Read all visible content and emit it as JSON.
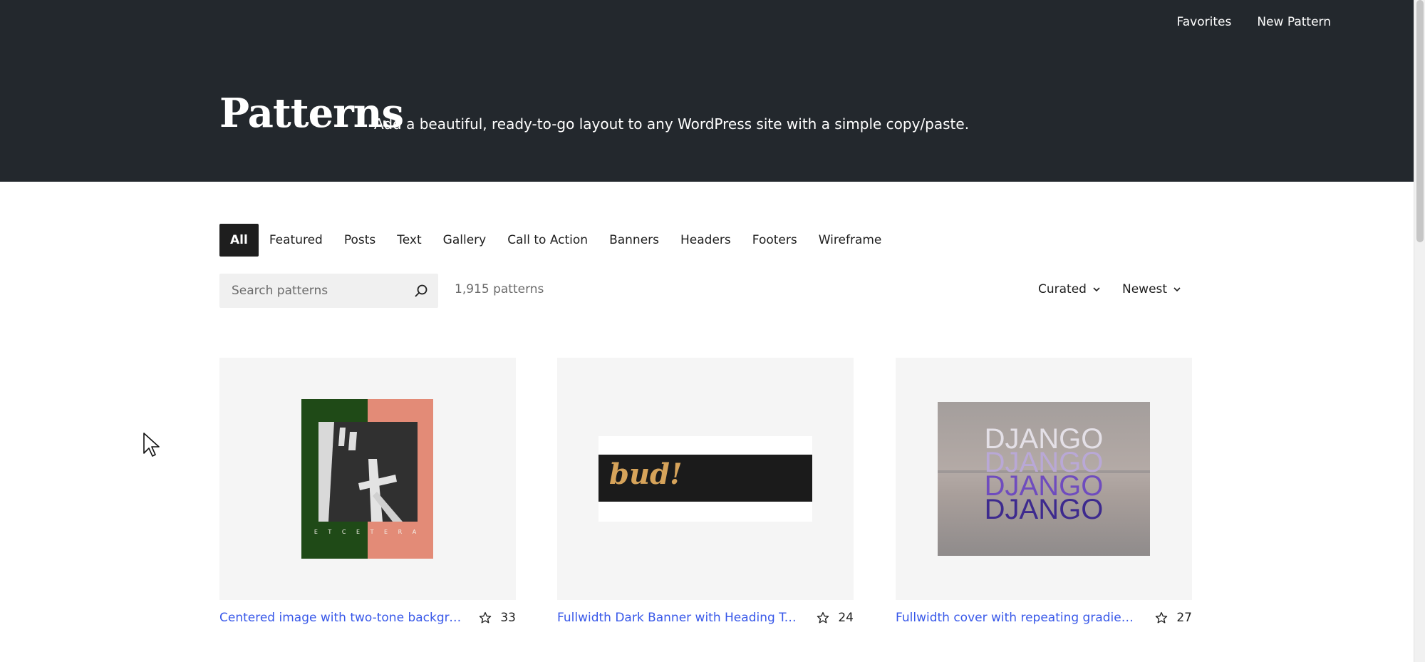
{
  "header": {
    "nav": [
      {
        "label": "Favorites"
      },
      {
        "label": "New Pattern"
      }
    ],
    "title": "Patterns",
    "tagline": "Add a beautiful, ready-to-go layout to any WordPress site with a simple copy/paste."
  },
  "categories": [
    {
      "label": "All",
      "active": true
    },
    {
      "label": "Featured"
    },
    {
      "label": "Posts"
    },
    {
      "label": "Text"
    },
    {
      "label": "Gallery"
    },
    {
      "label": "Call to Action"
    },
    {
      "label": "Banners"
    },
    {
      "label": "Headers"
    },
    {
      "label": "Footers"
    },
    {
      "label": "Wireframe"
    }
  ],
  "toolbar": {
    "search_placeholder": "Search patterns",
    "search_icon": "search-icon",
    "count": "1,915 patterns",
    "curated_label": "Curated",
    "sort_label": "Newest"
  },
  "cards": [
    {
      "title": "Centered image with two-tone backgrou...",
      "favorites": "33",
      "thumb_caption": "E T C E T E R A"
    },
    {
      "title": "Fullwidth Dark Banner with Heading Top ...",
      "favorites": "24",
      "thumb_text": "bud!"
    },
    {
      "title": "Fullwidth cover with repeating gradient t...",
      "favorites": "27",
      "thumb_words": [
        "DJANGO",
        "DJANGO",
        "DJANGO",
        "DJANGO"
      ]
    }
  ],
  "colors": {
    "header_bg": "#23282d",
    "link": "#3858e9",
    "active_tab_bg": "#1e1e1e"
  }
}
